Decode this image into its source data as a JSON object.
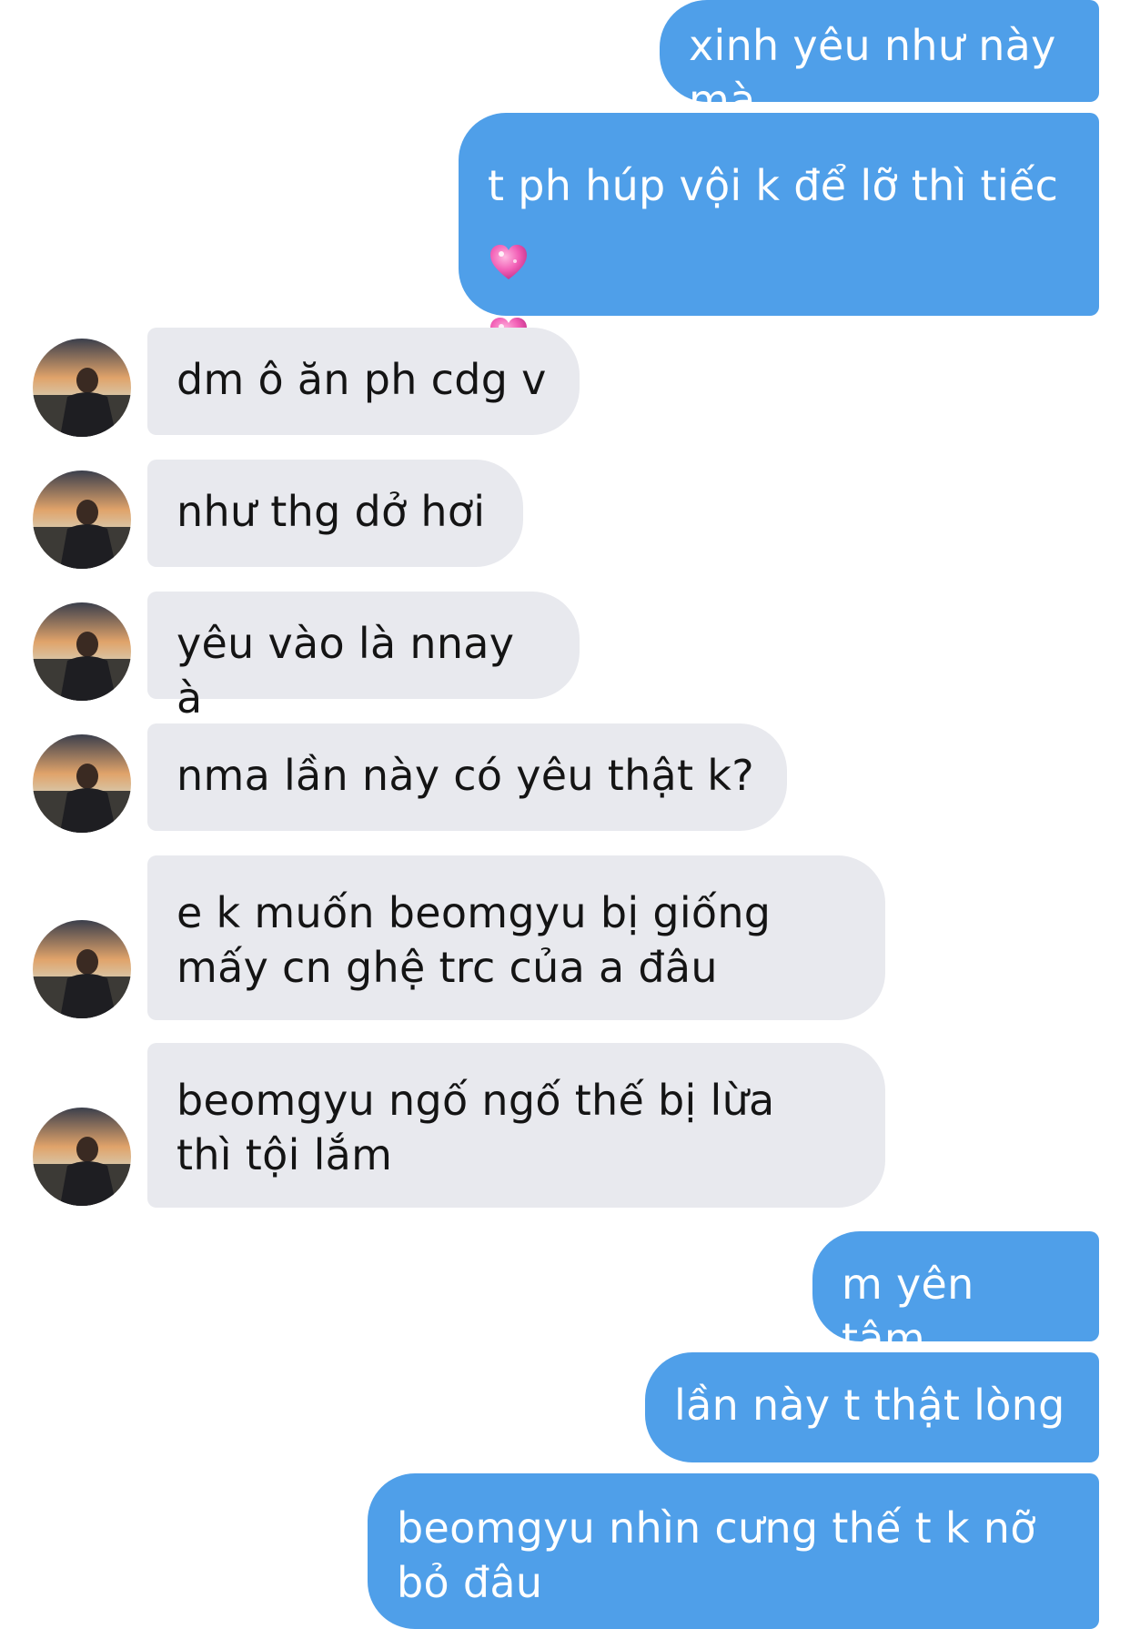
{
  "messages": [
    {
      "side": "out",
      "text": "xinh yêu như này mà"
    },
    {
      "side": "out",
      "text": "t ph húp vội k để lỡ thì tiếc",
      "icon": "sparkling-heart-icon"
    },
    {
      "side": "in",
      "text": "dm ô ăn ph cdg v"
    },
    {
      "side": "in",
      "text": "như thg dở hơi"
    },
    {
      "side": "in",
      "text": "yêu vào là nnay à"
    },
    {
      "side": "in",
      "text": "nma lần này có yêu thật k?"
    },
    {
      "side": "in",
      "text": "e k muốn beomgyu bị giống mấy cn ghệ trc của a đâu"
    },
    {
      "side": "in",
      "text": "beomgyu ngố ngố thế bị lừa thì tội lắm"
    },
    {
      "side": "out",
      "text": "m yên tâm"
    },
    {
      "side": "out",
      "text": "lần này t thật lòng"
    },
    {
      "side": "out",
      "text": "beomgyu nhìn cưng thế t k nỡ bỏ đâu"
    }
  ],
  "colors": {
    "outgoing_bubble": "#4f9fe9",
    "incoming_bubble": "#e8e9ee",
    "outgoing_text": "#ffffff",
    "incoming_text": "#141414"
  },
  "icons": {
    "avatar": "contact-avatar-icon",
    "emoji": "sparkling-heart-icon"
  }
}
